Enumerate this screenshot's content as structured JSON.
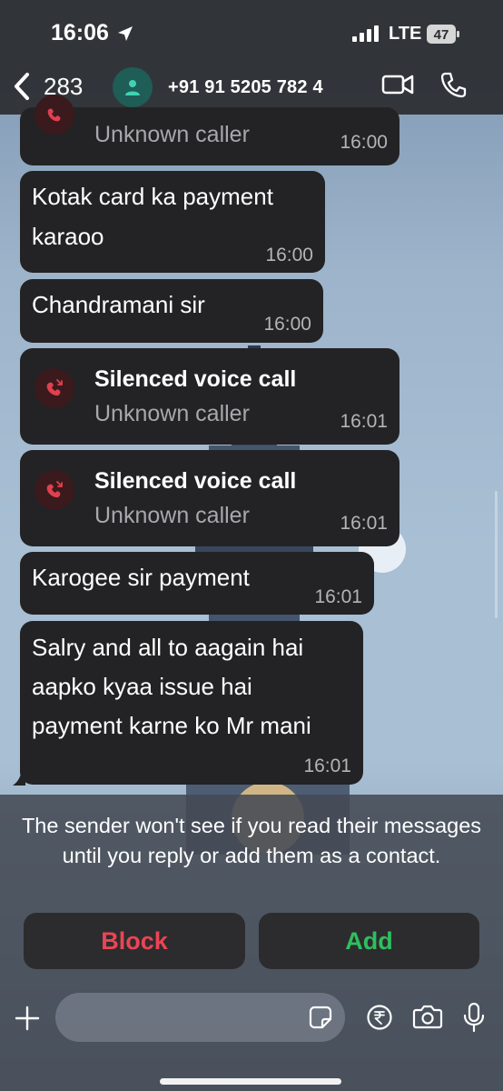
{
  "status_bar": {
    "time": "16:06",
    "network": "LTE",
    "battery": "47"
  },
  "header": {
    "back_count": "283",
    "contact_number": "+91 91 5205 782 4"
  },
  "messages": [
    {
      "kind": "call",
      "title": "",
      "subtitle": "Unknown caller",
      "time": "16:00"
    },
    {
      "kind": "text",
      "text": "Kotak card ka payment\nkaraoo",
      "time": "16:00"
    },
    {
      "kind": "text",
      "text": "Chandramani sir",
      "time": "16:00"
    },
    {
      "kind": "call",
      "title": "Silenced voice call",
      "subtitle": "Unknown caller",
      "time": "16:01"
    },
    {
      "kind": "call",
      "title": "Silenced voice call",
      "subtitle": "Unknown caller",
      "time": "16:01"
    },
    {
      "kind": "text",
      "text": "Karogee sir payment",
      "time": "16:01"
    },
    {
      "kind": "text",
      "text": "Salry and all to aagain hai\naapko kyaa issue hai\npayment karne ko Mr mani",
      "time": "16:01"
    }
  ],
  "notice": {
    "text": "The sender won't see if you read their messages until you reply or add them as a contact.",
    "block_label": "Block",
    "add_label": "Add"
  },
  "composer": {
    "placeholder": ""
  },
  "colors": {
    "block": "#ec4455",
    "add": "#2fbe5e",
    "bubble": "#232325",
    "missed_call": "#e0404f"
  }
}
